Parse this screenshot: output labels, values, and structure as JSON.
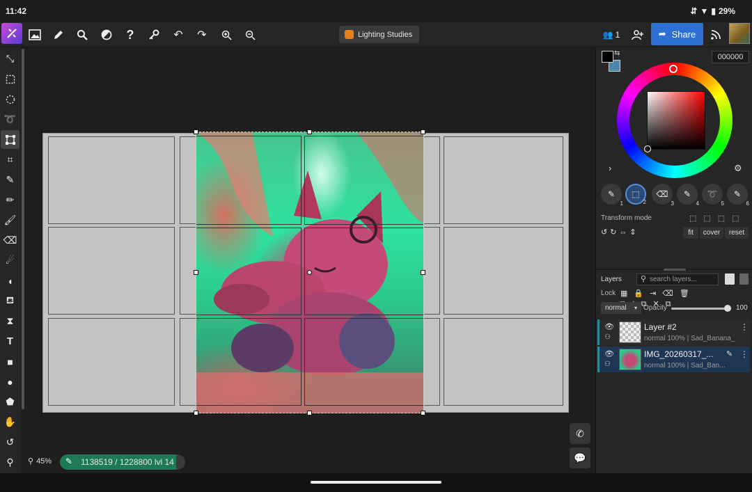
{
  "status_bar": {
    "time": "11:42",
    "battery": "29%"
  },
  "topbar": {
    "document_title": "Lighting Studies",
    "collaborators_count": "1",
    "share_label": "Share"
  },
  "canvas": {
    "zoom": "45%",
    "progress_text": "1138519 / 1228800  lvl 14",
    "progress_fraction": 0.9266
  },
  "color": {
    "hex": "000000",
    "foreground": "#000000",
    "background": "#4a87ad"
  },
  "brushes": [
    {
      "num": "1",
      "icon": "brush-icon"
    },
    {
      "num": "2",
      "icon": "transform-icon"
    },
    {
      "num": "3",
      "icon": "eraser-icon"
    },
    {
      "num": "4",
      "icon": "brush-icon"
    },
    {
      "num": "5",
      "icon": "lasso-icon"
    },
    {
      "num": "6",
      "icon": "brush-icon"
    }
  ],
  "transform": {
    "mode_label": "Transform mode",
    "fit": "fit",
    "cover": "cover",
    "reset": "reset"
  },
  "layers": {
    "title": "Layers",
    "search_placeholder": "search layers...",
    "lock_label": "Lock",
    "blend_mode": "normal",
    "opacity_label": "Opacity",
    "opacity_value": "100",
    "items": [
      {
        "name": "Layer #2",
        "meta": "normal 100% | Sad_Banana_"
      },
      {
        "name": "IMG_20260317_...",
        "meta": "normal 100% | Sad_Ban..."
      }
    ]
  }
}
